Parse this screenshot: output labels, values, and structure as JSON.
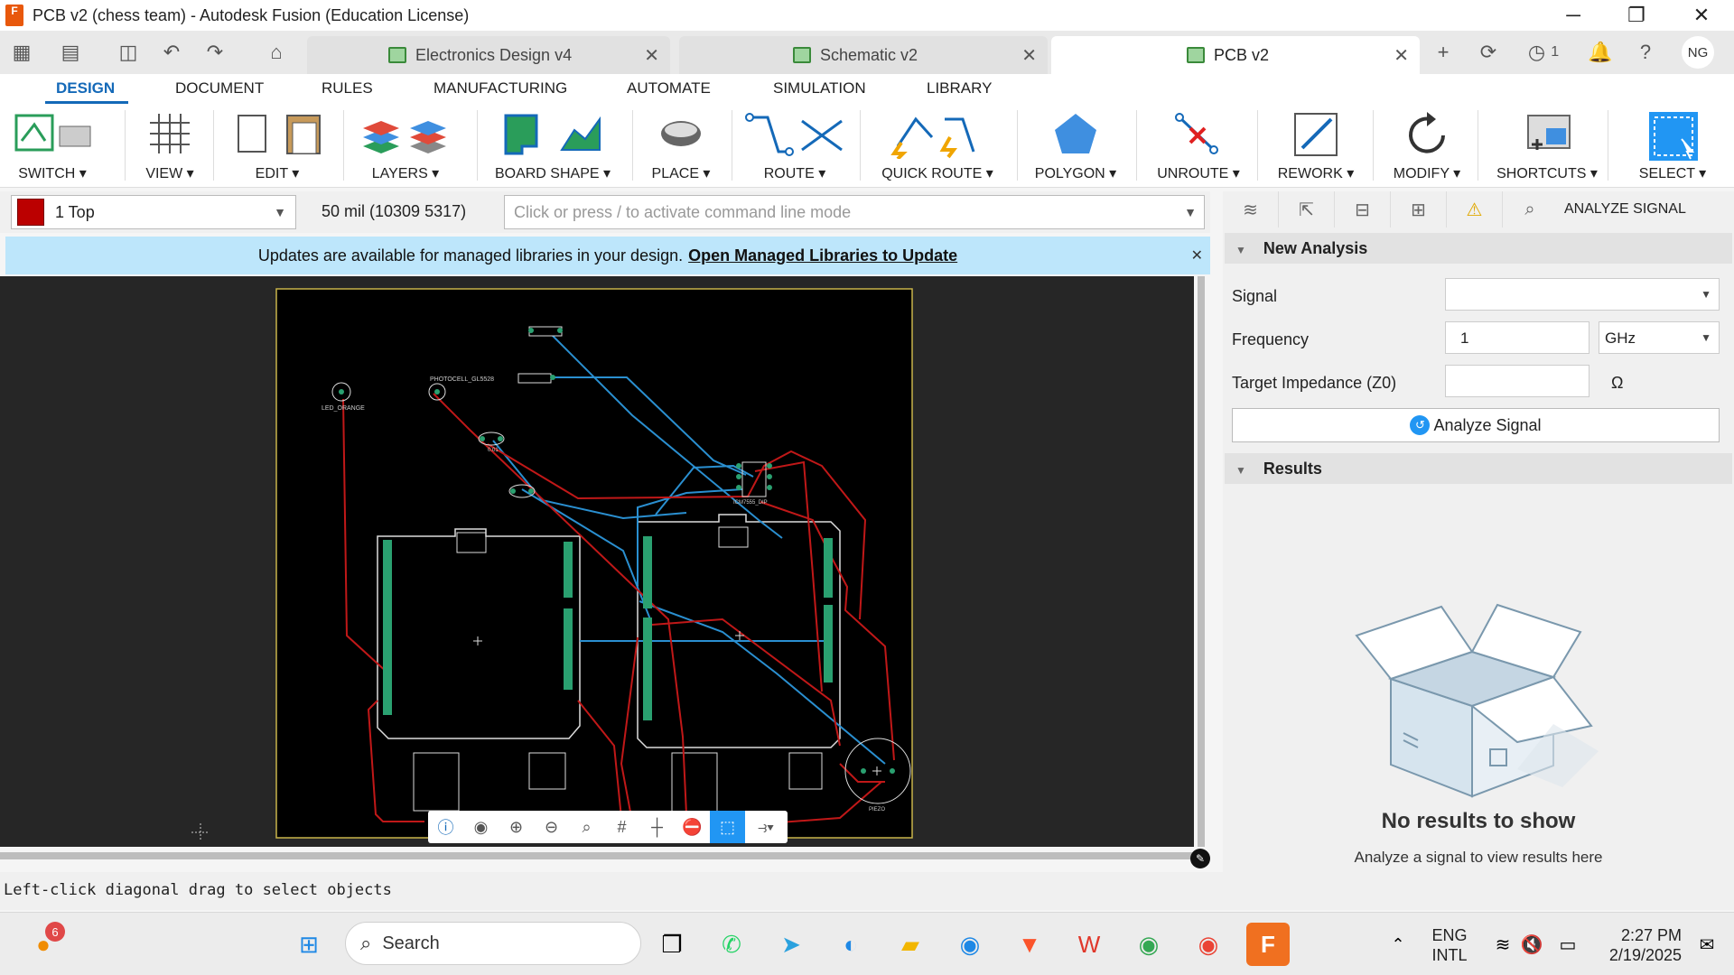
{
  "window": {
    "title": "PCB v2 (chess team) - Autodesk Fusion (Education License)",
    "logo_text": "F"
  },
  "tabs": [
    {
      "label": "Electronics Design v4"
    },
    {
      "label": "Schematic v2"
    },
    {
      "label": "PCB v2"
    }
  ],
  "toolbar_badges": {
    "jobs_count": "1",
    "user_initials": "NG"
  },
  "ribbon_tabs": [
    "DESIGN",
    "DOCUMENT",
    "RULES",
    "MANUFACTURING",
    "AUTOMATE",
    "SIMULATION",
    "LIBRARY"
  ],
  "ribbon_groups": [
    "SWITCH",
    "VIEW",
    "EDIT",
    "LAYERS",
    "BOARD SHAPE",
    "PLACE",
    "ROUTE",
    "QUICK ROUTE",
    "POLYGON",
    "UNROUTE",
    "REWORK",
    "MODIFY",
    "SHORTCUTS",
    "SELECT"
  ],
  "cmdbar": {
    "layer": "1 Top",
    "coordinates": "50 mil (10309 5317)",
    "cmd_placeholder": "Click or press / to activate command line mode"
  },
  "banner": {
    "text": "Updates are available for managed libraries in your design.",
    "link": "Open Managed Libraries to Update"
  },
  "board_labels": {
    "led": "LED_ORANGE",
    "photocell": "PHOTOCELL_GL5528",
    "cap": "0.01",
    "ic": "ICM7555_DIP",
    "piezo": "PIEZO"
  },
  "status_text": "Left-click diagonal drag to select objects",
  "panel": {
    "tab_title": "ANALYZE SIGNAL",
    "new_analysis": "New Analysis",
    "signal_label": "Signal",
    "signal_value": "",
    "frequency_label": "Frequency",
    "frequency_value": "1",
    "frequency_unit": "GHz",
    "impedance_label": "Target Impedance (Z0)",
    "impedance_value": "",
    "impedance_unit": "Ω",
    "analyze_button": "Analyze Signal",
    "results": "Results",
    "empty_title": "No results to show",
    "empty_sub": "Analyze a signal to view results here"
  },
  "taskbar": {
    "search_label": "Search",
    "notif_count": "6",
    "lang_line1": "ENG",
    "lang_line2": "INTL",
    "time": "2:27 PM",
    "date": "2/19/2025"
  }
}
